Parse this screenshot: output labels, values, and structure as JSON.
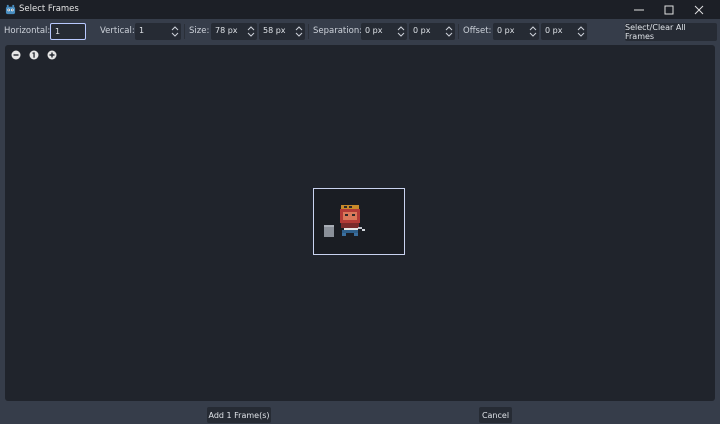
{
  "window": {
    "title": "Select Frames",
    "icon": "godot-icon"
  },
  "toolbar": {
    "horizontal_label": "Horizontal:",
    "horizontal_value": "1",
    "vertical_label": "Vertical:",
    "vertical_value": "1",
    "size_label": "Size:",
    "size_x": "78 px",
    "size_y": "58 px",
    "separation_label": "Separation:",
    "separation_x": "0 px",
    "separation_y": "0 px",
    "offset_label": "Offset:",
    "offset_x": "0 px",
    "offset_y": "0 px",
    "select_clear_label": "Select/Clear All Frames"
  },
  "zoom": {
    "out_icon": "zoom-out-icon",
    "reset_icon": "zoom-reset-icon",
    "in_icon": "zoom-in-icon"
  },
  "footer": {
    "add_label": "Add 1 Frame(s)",
    "cancel_label": "Cancel"
  },
  "colors": {
    "accent": "#b9c9ff",
    "panel": "#20242c",
    "toolbar": "#363d4a",
    "titlebar": "#1c1f26"
  }
}
